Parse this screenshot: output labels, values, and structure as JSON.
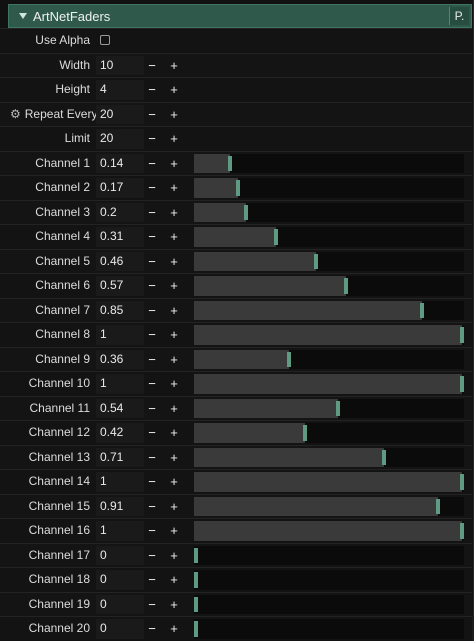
{
  "header": {
    "title": "ArtNetFaders",
    "p_button": "P."
  },
  "settings": [
    {
      "label": "Use Alpha",
      "type": "checkbox",
      "checked": false
    },
    {
      "label": "Width",
      "type": "number",
      "value": "10"
    },
    {
      "label": "Height",
      "type": "number",
      "value": "4"
    },
    {
      "label": "Repeat Every",
      "type": "number",
      "value": "20",
      "icon": "gear-icon"
    },
    {
      "label": "Limit",
      "type": "number",
      "value": "20"
    }
  ],
  "controls": {
    "minus": "−",
    "plus": "+"
  },
  "channels": [
    {
      "label": "Channel 1",
      "value": "0.14",
      "level": 0.14
    },
    {
      "label": "Channel 2",
      "value": "0.17",
      "level": 0.17
    },
    {
      "label": "Channel 3",
      "value": "0.2",
      "level": 0.2
    },
    {
      "label": "Channel 4",
      "value": "0.31",
      "level": 0.31
    },
    {
      "label": "Channel 5",
      "value": "0.46",
      "level": 0.46
    },
    {
      "label": "Channel 6",
      "value": "0.57",
      "level": 0.57
    },
    {
      "label": "Channel 7",
      "value": "0.85",
      "level": 0.85
    },
    {
      "label": "Channel 8",
      "value": "1",
      "level": 1
    },
    {
      "label": "Channel 9",
      "value": "0.36",
      "level": 0.36
    },
    {
      "label": "Channel 10",
      "value": "1",
      "level": 1
    },
    {
      "label": "Channel 11",
      "value": "0.54",
      "level": 0.54
    },
    {
      "label": "Channel 12",
      "value": "0.42",
      "level": 0.42
    },
    {
      "label": "Channel 13",
      "value": "0.71",
      "level": 0.71
    },
    {
      "label": "Channel 14",
      "value": "1",
      "level": 1
    },
    {
      "label": "Channel 15",
      "value": "0.91",
      "level": 0.91
    },
    {
      "label": "Channel 16",
      "value": "1",
      "level": 1
    },
    {
      "label": "Channel 17",
      "value": "0",
      "level": 0
    },
    {
      "label": "Channel 18",
      "value": "0",
      "level": 0
    },
    {
      "label": "Channel 19",
      "value": "0",
      "level": 0
    },
    {
      "label": "Channel 20",
      "value": "0",
      "level": 0
    }
  ],
  "colors": {
    "header_bg": "#2f5a4b",
    "handle": "#5f9b83",
    "fill": "#3a3a3a",
    "track": "#0b0b0b"
  }
}
